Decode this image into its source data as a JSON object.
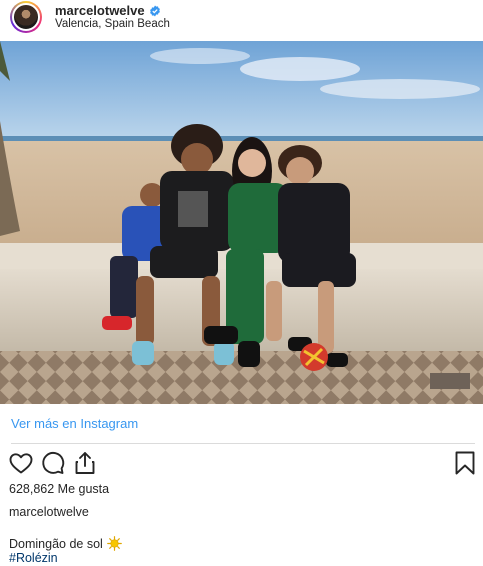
{
  "header": {
    "username": "marcelotwelve",
    "location": "Valencia, Spain Beach",
    "verified": true
  },
  "post": {
    "view_more_label": "Ver más en Instagram",
    "likes_text": "628,862 Me gusta",
    "author": "marcelotwelve",
    "caption": "Domingão de sol",
    "caption_emoji": "sun-emoji",
    "hashtag": "#Rolézin"
  },
  "icons": {
    "like": "heart-icon",
    "comment": "comment-icon",
    "share": "share-icon",
    "save": "bookmark-icon"
  },
  "colors": {
    "link_blue": "#3897f0",
    "verified_blue": "#3897f0",
    "text": "#262626",
    "hashtag": "#00376b"
  }
}
